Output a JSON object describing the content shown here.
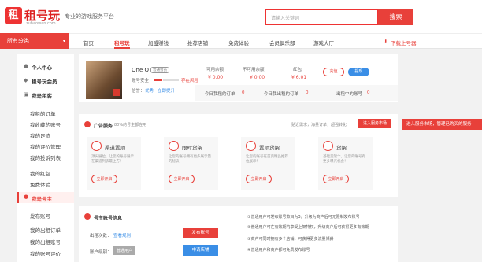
{
  "brand": {
    "logo_glyph": "租",
    "name": "租号玩",
    "domain": "zuhaowan.com",
    "slogan": "专业的游戏服务平台"
  },
  "search": {
    "placeholder": "请输入关键词",
    "button": "搜索"
  },
  "nav": {
    "category": "所有分类",
    "items": [
      "首页",
      "租号玩",
      "加盟赚钱",
      "推荐店铺",
      "免费体验",
      "会员俱乐部",
      "游戏大厅"
    ],
    "download": "下载上号器"
  },
  "sidebar": {
    "personal": "个人中心",
    "member": "租号玩会员",
    "renter_head": "我是租客",
    "renter_items": [
      "我租的订单",
      "我收藏的账号",
      "我的足迹",
      "我的评价管理",
      "我的投诉列表",
      "我的红包",
      "免费体验"
    ],
    "owner_head": "我是号主",
    "owner_items": [
      "发布账号",
      "我的出租订单",
      "我的出租账号",
      "我的账号评价"
    ]
  },
  "profile": {
    "username": "One Q",
    "badge": "普通会员",
    "security_label": "账号安全：",
    "risk": "存在风险",
    "credit_label": "信誉：",
    "credit_value": "优秀",
    "upgrade": "立即提升",
    "balances": [
      {
        "label": "可用余额",
        "value": "¥ 0.00"
      },
      {
        "label": "不可用余额",
        "value": "¥ 0.00"
      },
      {
        "label": "红包",
        "value": "¥ 6.01"
      }
    ],
    "recharge": "充值",
    "withdraw": "提现",
    "stats": [
      "今日我租的订单",
      "今日我出租的订单",
      "出租中的账号"
    ],
    "stat_values": [
      "0",
      "0",
      "0"
    ]
  },
  "ad_service": {
    "title": "广告服务",
    "subtitle": "80%的号主都在用",
    "right_text": "贴近需求，海量订单，超强转化",
    "enter_button": "进入服务市场",
    "tip": "进入服务市场，管理已购买的服务",
    "features": [
      {
        "title": "渠道置顶",
        "desc": "顶尖展位，让您的账号展示在渠道列表最上方！",
        "action": "立即开启"
      },
      {
        "title": "限时货架",
        "desc": "让您的账号拥有更多展示量的秘诀！",
        "action": "立即开启"
      },
      {
        "title": "置顶货架",
        "desc": "让您的账号在首页精品推荐位展示！",
        "action": "立即开启"
      },
      {
        "title": "货架",
        "desc": "基础货架个，让您的账号有更多曝光机会！",
        "action": "立即开启"
      }
    ]
  },
  "account_info": {
    "title": "号主账号信息",
    "publish_label": "出租次数：",
    "publish_value": "查看规则",
    "level_label": "账户级别：",
    "level_value": "普通用户",
    "publish_button": "发布账号",
    "apply_button": "申请店铺",
    "notes": [
      "①普通用户可发布账号数目为3，升级为商户后可无限制发布账号",
      "②普通用户可在有效期内享受上架特权，升级商户后可获得更多有效期",
      "③商户可同时拥有多个店铺，可获得更多流量倾斜",
      "④普通用户和商户都可免费发布账号"
    ]
  }
}
